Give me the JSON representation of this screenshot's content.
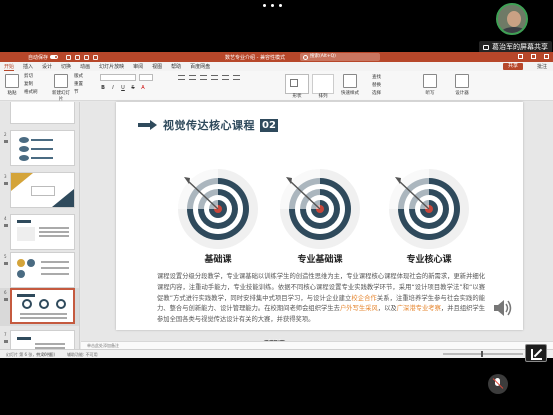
{
  "meeting": {
    "share_label": "葛治军的屏幕共享"
  },
  "app": {
    "autosave_label": "自动保存",
    "toggle_state": "关",
    "doc_title": "数艺专业介绍 - 兼容性模式",
    "search_placeholder": "搜索(Alt+Q)",
    "tabs": [
      "开始",
      "插入",
      "设计",
      "切换",
      "动画",
      "幻灯片放映",
      "审阅",
      "视图",
      "帮助",
      "百度网盘"
    ],
    "active_tab": "开始",
    "share_button": "共享",
    "comment_button": "批注",
    "ribbon": {
      "paste": "粘贴",
      "cut": "剪切",
      "copy": "复制",
      "format_painter": "格式刷",
      "new_slide": "新建幻灯片",
      "layout": "版式",
      "reset": "重置",
      "section": "节",
      "shapes": "形状",
      "arrange": "排列",
      "quick_styles": "快速样式",
      "find": "查找",
      "replace": "替换",
      "select": "选择",
      "dictate": "听写",
      "designer": "设计器"
    }
  },
  "thumbnails": [
    {
      "num": "1",
      "active": false
    },
    {
      "num": "2",
      "active": false
    },
    {
      "num": "3",
      "active": false
    },
    {
      "num": "4",
      "active": false
    },
    {
      "num": "5",
      "active": false
    },
    {
      "num": "6",
      "active": true
    },
    {
      "num": "7",
      "active": false
    },
    {
      "num": "8",
      "active": false
    }
  ],
  "slide": {
    "title": "视觉传达核心课程",
    "title_number": "02",
    "courses": [
      {
        "label": "基础课"
      },
      {
        "label": "专业基础课"
      },
      {
        "label": "专业核心课"
      }
    ],
    "body_part1": "课程设置分级分段教学，专业课基础以训练学生的创造性思维为主，专业课程核心课程体现社会的新需求，更新并细化课程内容，注重动手能力，专业技能训练。依据不同核心课程设置专业实践教学环节，采用“设计项目教学法”和“以赛促教”方式进行实践教学，同时安排集中式项目学习，与设计企业建立",
    "body_hl1": "校企合作",
    "body_part2": "关系，注重培养学生参与社会实践的能力、整合与创新能力、设计管理能力。在校期间老师会组织学生去",
    "body_hl2": "户外写生采风",
    "body_part3": "，以及",
    "body_hl3": "广深港专业考察",
    "body_part4": "，并且组织学生参加全国各类与视觉传达设计有关的大赛，并获得奖项。"
  },
  "page_indicator": "6 / 26",
  "notes_placeholder": "单击此处添加备注",
  "status": {
    "slide_info": "幻灯片 第 6 张，共 26 张",
    "language": "中文(中国)",
    "accessibility": "辅助功能: 不可用"
  },
  "colors": {
    "accent": "#b7472a",
    "title_dark": "#2f4a5c",
    "highlight": "#e6862f",
    "target_red": "#c9463a"
  }
}
